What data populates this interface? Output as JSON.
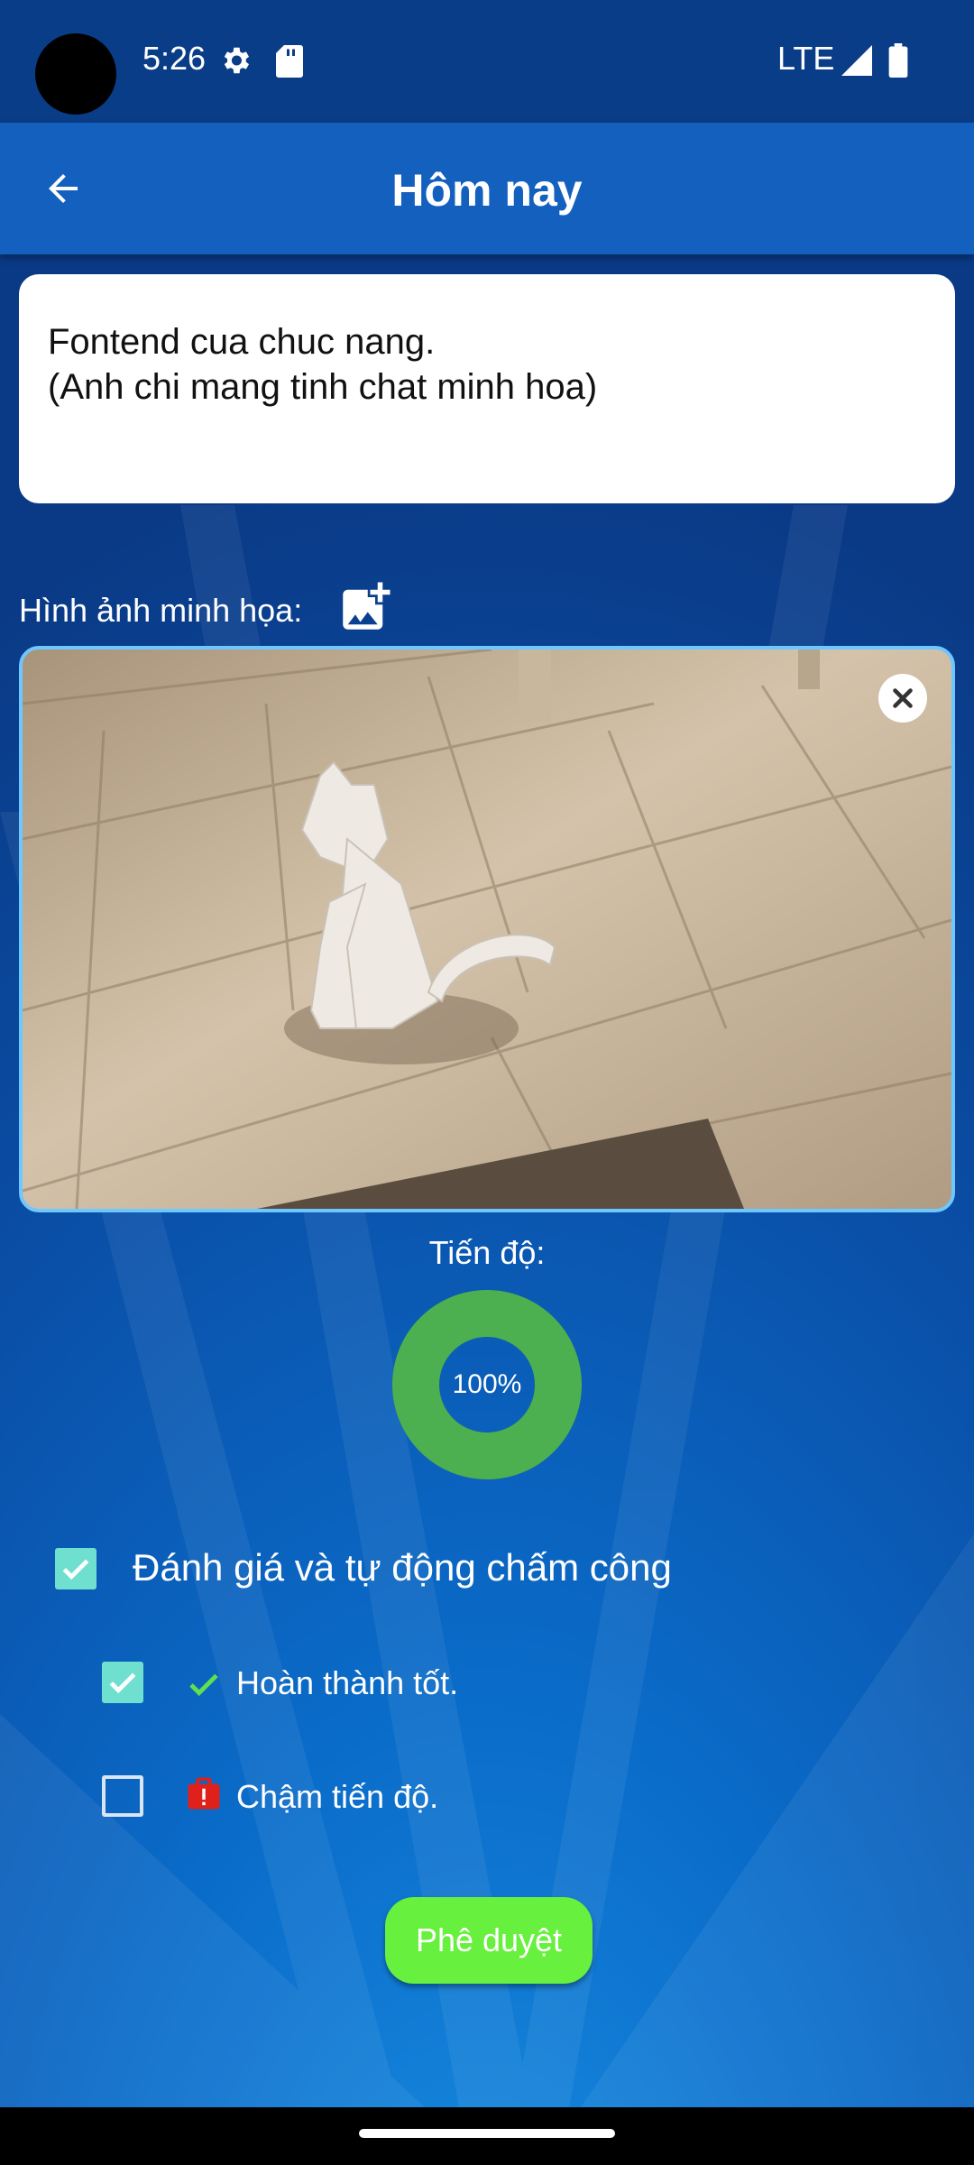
{
  "status_bar": {
    "time": "5:26",
    "network": "LTE"
  },
  "app_bar": {
    "title": "Hôm nay"
  },
  "note": {
    "lines": [
      "Fontend cua chuc nang.",
      "(Anh chi mang tinh chat minh hoa)"
    ]
  },
  "image_section": {
    "label": "Hình ảnh minh họa:"
  },
  "progress": {
    "label": "Tiến độ:",
    "value_text": "100%",
    "fraction": 1.0,
    "color": "#4caf50"
  },
  "evaluation": {
    "label": "Đánh giá và tự động chấm công",
    "checked": true,
    "options": [
      {
        "label": "Hoàn thành tốt.",
        "checked": true
      },
      {
        "label": "Chậm tiến độ.",
        "checked": false
      }
    ]
  },
  "approve_button": {
    "label": "Phê duyệt"
  },
  "colors": {
    "status_bar": "#0a3d87",
    "app_bar": "#1360be",
    "checkbox_checked": "#6fe0d0",
    "approve_button": "#67f03e",
    "alert_icon": "#e0201b"
  }
}
